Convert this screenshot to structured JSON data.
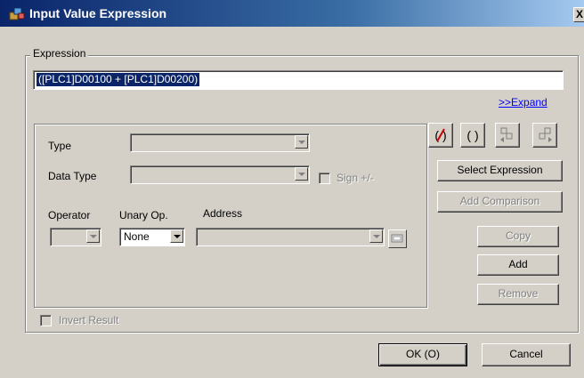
{
  "window": {
    "title": "Input Value Expression",
    "close_glyph": "X"
  },
  "expression": {
    "group_label": "Expression",
    "value": "([PLC1]D00100 + [PLC1]D00200)",
    "expand_link": ">>Expand"
  },
  "editor": {
    "type_label": "Type",
    "type_value": "",
    "data_type_label": "Data Type",
    "data_type_value": "",
    "sign_label": "Sign +/-",
    "operator_label": "Operator",
    "operator_value": "",
    "unary_label": "Unary Op.",
    "unary_value": "None",
    "address_label": "Address",
    "address_value": ""
  },
  "tool_icons": [
    "clear-icon",
    "parentheses-icon",
    "move-left-icon",
    "move-right-icon"
  ],
  "tool_glyphs": {
    "clear": "(/)",
    "parentheses": "( )"
  },
  "buttons": {
    "select_expression": "Select Expression",
    "add_comparison": "Add Comparison",
    "copy": "Copy",
    "add": "Add",
    "remove": "Remove",
    "ok": "OK (O)",
    "cancel": "Cancel"
  },
  "invert_label": "Invert Result",
  "colors": {
    "dialog_bg": "#d4d0c8",
    "title_start": "#0a246a",
    "title_end": "#a6caf0",
    "selection": "#0a246a",
    "link": "#0000ff",
    "clear_icon": "#cc0000"
  }
}
